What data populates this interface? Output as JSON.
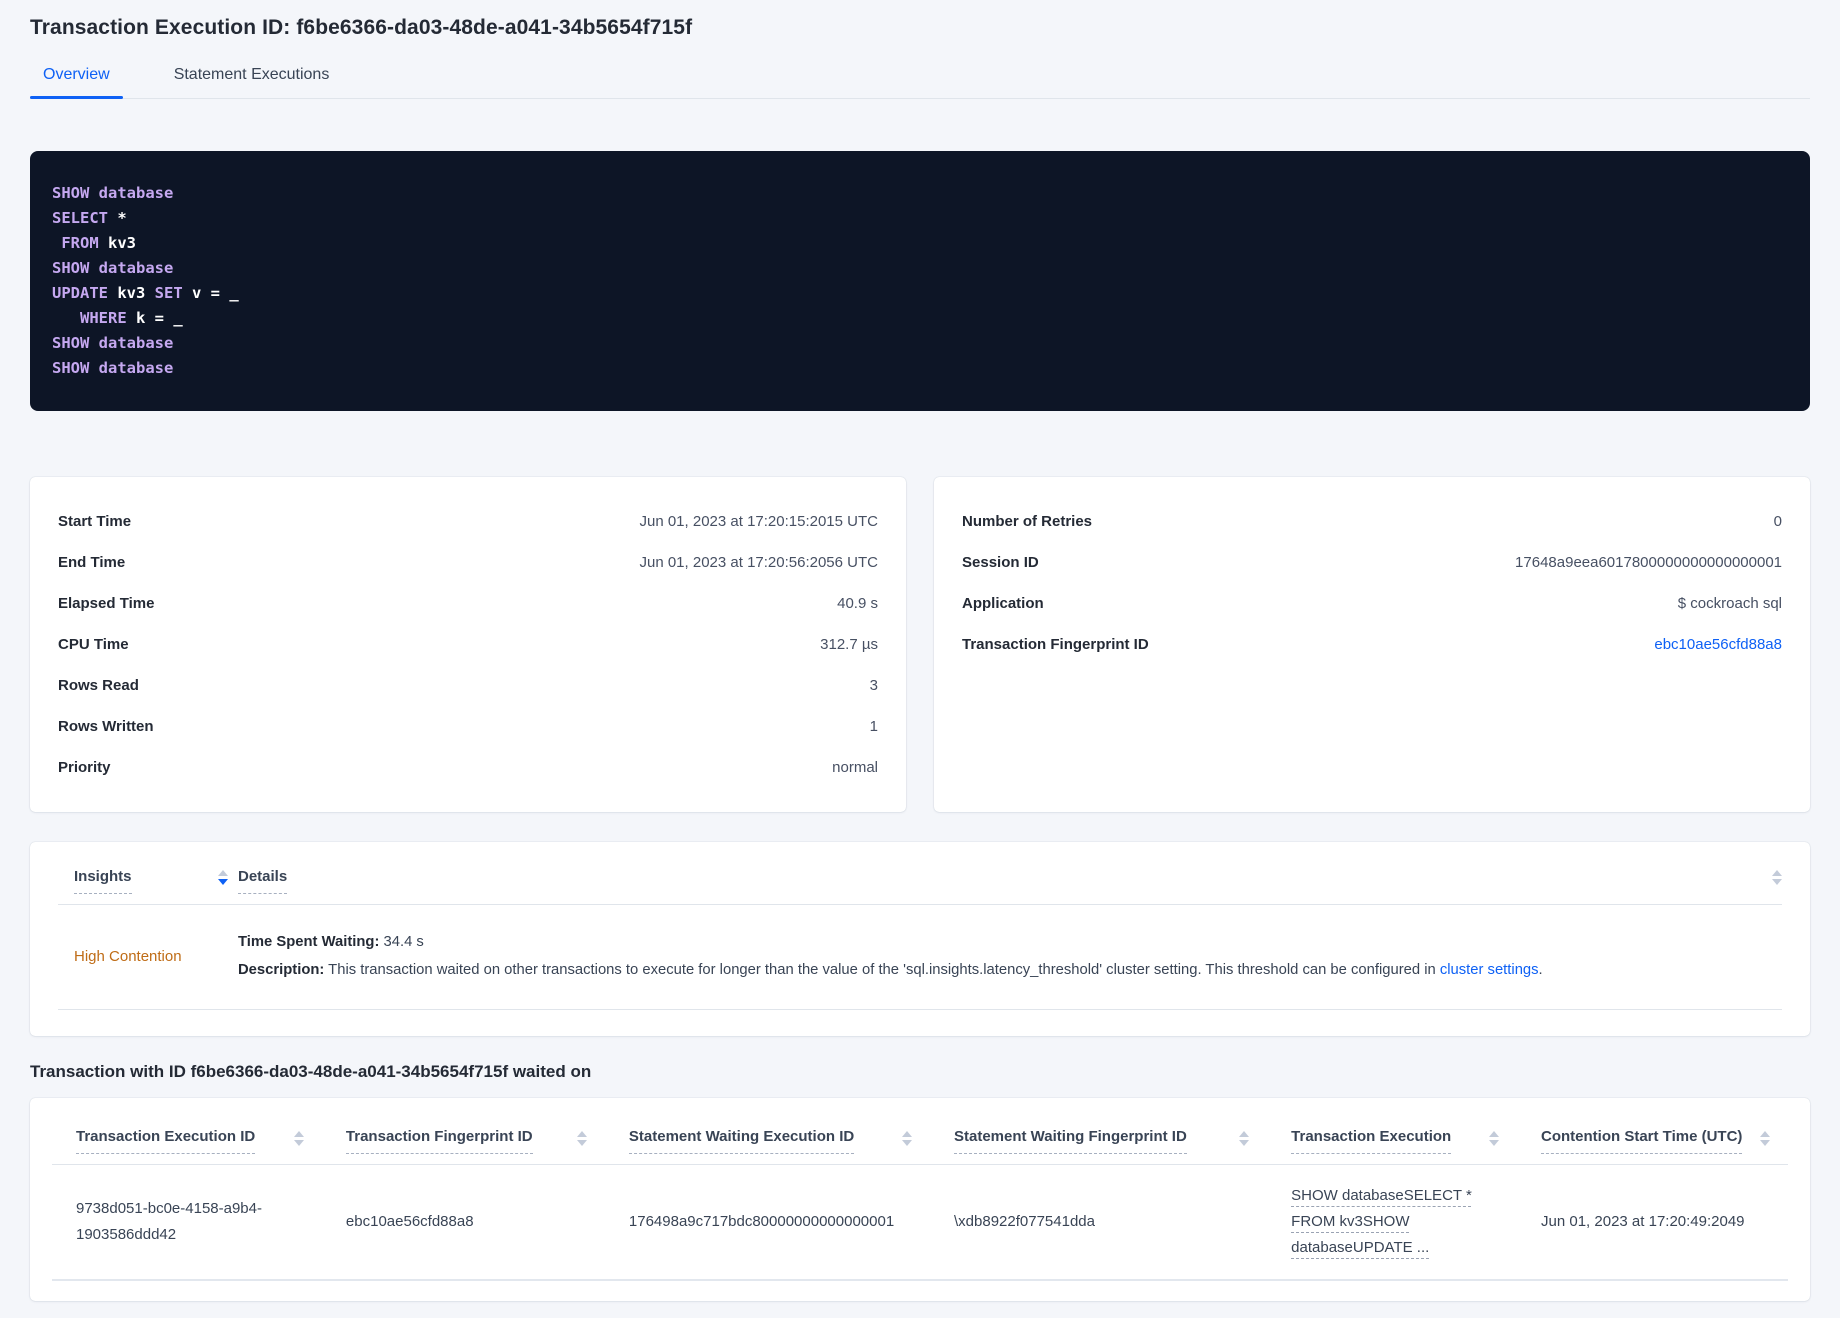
{
  "page": {
    "title": "Transaction Execution ID: f6be6366-da03-48de-a041-34b5654f715f"
  },
  "tabs": [
    {
      "label": "Overview",
      "active": true
    },
    {
      "label": "Statement Executions",
      "active": false
    }
  ],
  "colors": {
    "accent_blue": "#0e61f5",
    "insight_warning_orange": "#bf6c16",
    "code_background": "#0d1526",
    "code_keyword": "#c5a8f0",
    "code_identifier": "#ffffff"
  },
  "icons": {
    "sort": "sort-arrows-icon"
  },
  "sql_box": {
    "lines": [
      [
        [
          "kw",
          "SHOW"
        ],
        [
          "id",
          " "
        ],
        [
          "kw",
          "database"
        ]
      ],
      [
        [
          "kw",
          "SELECT"
        ],
        [
          "id",
          " *"
        ]
      ],
      [
        [
          "id",
          " "
        ],
        [
          "kw",
          "FROM"
        ],
        [
          "id",
          " kv3"
        ]
      ],
      [
        [
          "kw",
          "SHOW"
        ],
        [
          "id",
          " "
        ],
        [
          "kw",
          "database"
        ]
      ],
      [
        [
          "kw",
          "UPDATE"
        ],
        [
          "id",
          " kv3 "
        ],
        [
          "kw",
          "SET"
        ],
        [
          "id",
          " v = _"
        ]
      ],
      [
        [
          "id",
          "   "
        ],
        [
          "kw",
          "WHERE"
        ],
        [
          "id",
          " k = _"
        ]
      ],
      [
        [
          "kw",
          "SHOW"
        ],
        [
          "id",
          " "
        ],
        [
          "kw",
          "database"
        ]
      ],
      [
        [
          "kw",
          "SHOW"
        ],
        [
          "id",
          " "
        ],
        [
          "kw",
          "database"
        ]
      ]
    ]
  },
  "summary_left": [
    {
      "label": "Start Time",
      "value": "Jun 01, 2023 at 17:20:15:2015 UTC"
    },
    {
      "label": "End Time",
      "value": "Jun 01, 2023 at 17:20:56:2056 UTC"
    },
    {
      "label": "Elapsed Time",
      "value": "40.9 s"
    },
    {
      "label": "CPU Time",
      "value": "312.7 µs"
    },
    {
      "label": "Rows Read",
      "value": "3"
    },
    {
      "label": "Rows Written",
      "value": "1"
    },
    {
      "label": "Priority",
      "value": "normal"
    }
  ],
  "summary_right": [
    {
      "label": "Number of Retries",
      "value": "0"
    },
    {
      "label": "Session ID",
      "value": "17648a9eea6017800000000000000001"
    },
    {
      "label": "Application",
      "value": "$ cockroach sql"
    },
    {
      "label": "Transaction Fingerprint ID",
      "value": "ebc10ae56cfd88a8",
      "link": true
    }
  ],
  "insights": {
    "columns": [
      "Insights",
      "Details"
    ],
    "sort_state": "descending",
    "row": {
      "insight": "High Contention",
      "waiting_label": "Time Spent Waiting:",
      "waiting_value": " 34.4 s",
      "description_label": "Description:",
      "description_text": " This transaction waited on other transactions to execute for longer than the value of the 'sql.insights.latency_threshold' cluster setting. This threshold can be configured in ",
      "description_link": "cluster settings",
      "description_suffix": "."
    }
  },
  "waited_on": {
    "heading": "Transaction with ID f6be6366-da03-48de-a041-34b5654f715f waited on",
    "columns": [
      "Transaction Execution ID",
      "Transaction Fingerprint ID",
      "Statement Waiting Execution ID",
      "Statement Waiting Fingerprint ID",
      "Transaction Execution",
      "Contention Start Time (UTC)"
    ],
    "rows": [
      [
        "9738d051-bc0e-4158-a9b4-1903586ddd42",
        "ebc10ae56cfd88a8",
        "176498a9c717bdc80000000000000001",
        "\\xdb8922f077541dda",
        "SHOW databaseSELECT * FROM kv3SHOW databaseUPDATE ...",
        "Jun 01, 2023 at 17:20:49:2049"
      ]
    ]
  }
}
